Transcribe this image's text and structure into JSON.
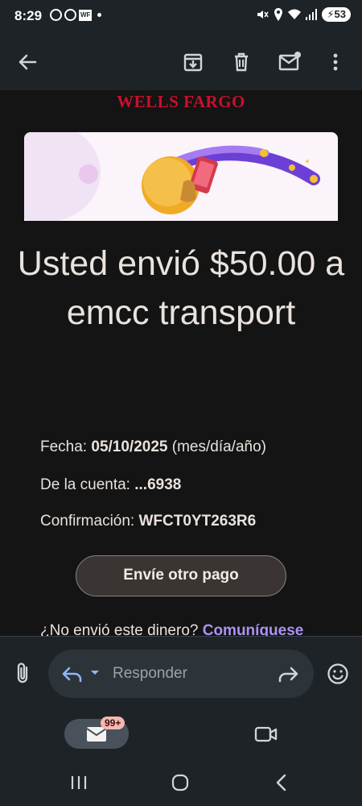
{
  "status_bar": {
    "time": "8:29",
    "wf_icon_text": "WF",
    "battery": "53"
  },
  "email": {
    "brand": "WELLS FARGO",
    "headline": "Usted envió $50.00 a emcc transport",
    "date_label": "Fecha:",
    "date_value": "05/10/2025",
    "date_format": "(mes/día/año)",
    "account_label": "De la cuenta:",
    "account_value": "...6938",
    "confirmation_label": "Confirmación:",
    "confirmation_value": "WFCT0YT263R6",
    "button_label": "Envíe otro pago",
    "footnote_text": "¿No envió este dinero?",
    "footnote_link": "Comuníquese"
  },
  "reply": {
    "placeholder": "Responder"
  },
  "bottom_nav": {
    "mail_badge": "99+"
  },
  "colors": {
    "brand_red": "#c8102e",
    "link_purple": "#a992f3",
    "bar_bg": "#1d2327"
  },
  "icons": [
    "back-arrow-icon",
    "archive-icon",
    "trash-icon",
    "mark-unread-icon",
    "more-vert-icon",
    "attach-icon",
    "reply-icon",
    "dropdown-icon",
    "forward-icon",
    "emoji-icon",
    "mail-icon",
    "video-icon",
    "recents-icon",
    "home-icon",
    "back-nav-icon"
  ]
}
